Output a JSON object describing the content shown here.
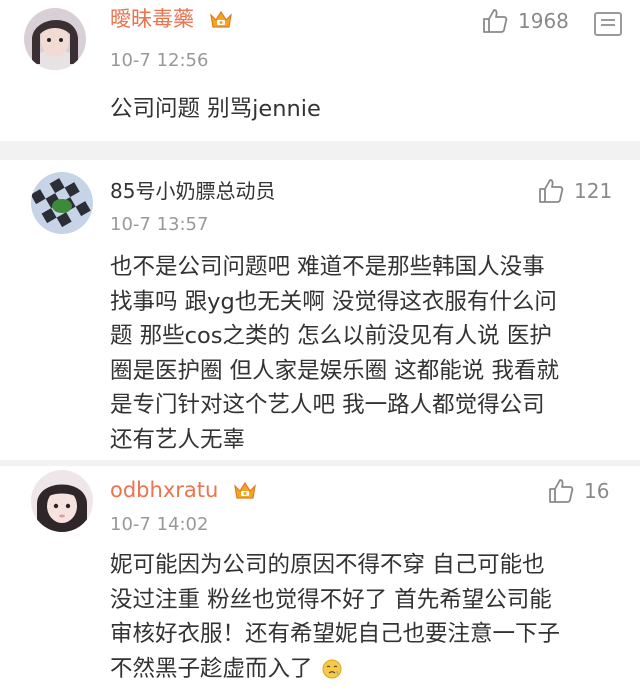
{
  "comments": [
    {
      "user": "曖昧毒藥",
      "time": "10-7 12:56",
      "likes": "1968",
      "text": [
        "公司问题 别骂jennie"
      ],
      "vip": true
    },
    {
      "user": "85号小奶膘总动员",
      "time": "10-7 13:57",
      "likes": "121",
      "text": [
        "也不是公司问题吧 难道不是那些韩国人没事",
        "找事吗 跟yg也无关啊 没觉得这衣服有什么问",
        "题 那些cos之类的 怎么以前没见有人说 医护",
        "圈是医护圈 但人家是娱乐圈 这都能说 我看就",
        "是专门针对这个艺人吧 我一路人都觉得公司",
        "还有艺人无辜"
      ],
      "vip": false
    },
    {
      "user": "odbhxratu",
      "time": "10-7 14:02",
      "likes": "16",
      "text": [
        "妮可能因为公司的原因不得不穿 自己可能也",
        "没过注重 粉丝也觉得不好了 首先希望公司能",
        "审核好衣服！还有希望妮自己也要注意一下子",
        "不然黑子趁虚而入了"
      ],
      "vip": true
    }
  ],
  "colors": {
    "vip_name": "#eb7350",
    "name": "#333333",
    "time": "#999999",
    "background": "#f2f2f2",
    "card": "#ffffff"
  },
  "icons": [
    "avatar",
    "crown-vip-icon",
    "thumbs-up-icon",
    "comment-menu-icon",
    "emoji-icon"
  ]
}
